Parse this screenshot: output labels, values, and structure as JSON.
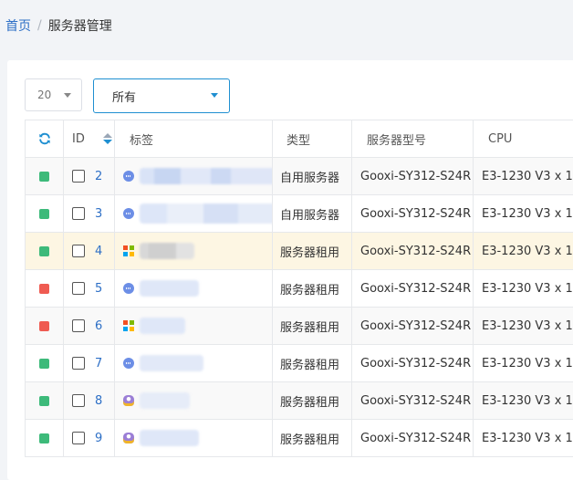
{
  "breadcrumb": {
    "home": "首页",
    "separator": "/",
    "current": "服务器管理"
  },
  "filters": {
    "page_size": "20",
    "type_filter": "所有"
  },
  "colors": {
    "accent": "#1f8fd1",
    "status_green": "#3dba7a",
    "status_red": "#ef5b52",
    "highlight_row": "#fdf6e3"
  },
  "table": {
    "headers": {
      "id": "ID",
      "tag": "标签",
      "type": "类型",
      "model": "服务器型号",
      "cpu": "CPU"
    },
    "rows": [
      {
        "status": "green",
        "id": "2",
        "os_icon": "dots-icon",
        "type": "自用服务器",
        "model": "Gooxi-SY312-S24R",
        "cpu": "E3-1230 V3 x 1"
      },
      {
        "status": "green",
        "id": "3",
        "os_icon": "dots-icon",
        "type": "自用服务器",
        "model": "Gooxi-SY312-S24R",
        "cpu": "E3-1230 V3 x 1"
      },
      {
        "status": "green",
        "id": "4",
        "os_icon": "windows-icon",
        "type": "服务器租用",
        "model": "Gooxi-SY312-S24R",
        "cpu": "E3-1230 V3 x 1"
      },
      {
        "status": "red",
        "id": "5",
        "os_icon": "dots-icon",
        "type": "服务器租用",
        "model": "Gooxi-SY312-S24R",
        "cpu": "E3-1230 V3 x 1"
      },
      {
        "status": "red",
        "id": "6",
        "os_icon": "windows-icon",
        "type": "服务器租用",
        "model": "Gooxi-SY312-S24R",
        "cpu": "E3-1230 V3 x 1"
      },
      {
        "status": "green",
        "id": "7",
        "os_icon": "dots-icon",
        "type": "服务器租用",
        "model": "Gooxi-SY312-S24R",
        "cpu": "E3-1230 V3 x 1"
      },
      {
        "status": "green",
        "id": "8",
        "os_icon": "linux-icon",
        "type": "服务器租用",
        "model": "Gooxi-SY312-S24R",
        "cpu": "E3-1230 V3 x 1"
      },
      {
        "status": "green",
        "id": "9",
        "os_icon": "linux-icon",
        "type": "服务器租用",
        "model": "Gooxi-SY312-S24R",
        "cpu": "E3-1230 V3 x 1"
      }
    ]
  }
}
